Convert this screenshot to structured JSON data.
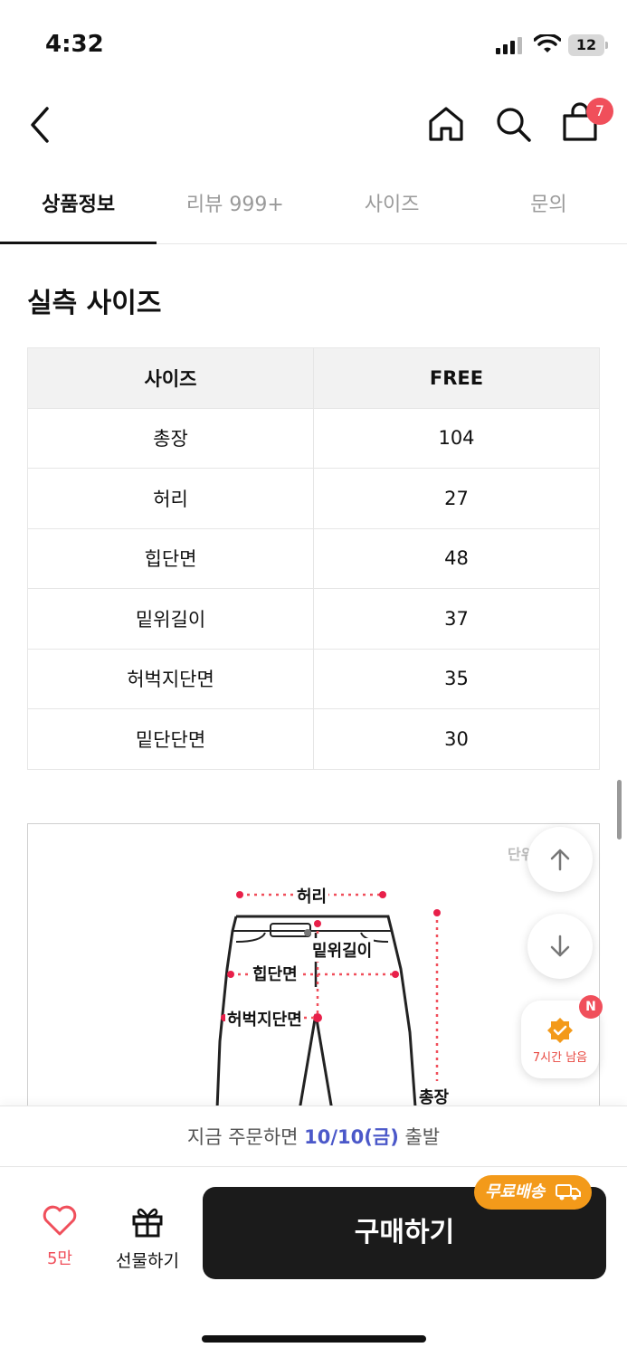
{
  "status_bar": {
    "time": "4:32",
    "battery": "12"
  },
  "header": {
    "cart_count": "7"
  },
  "tabs": [
    {
      "label": "상품정보",
      "active": true
    },
    {
      "label": "리뷰 999+",
      "active": false
    },
    {
      "label": "사이즈",
      "active": false
    },
    {
      "label": "문의",
      "active": false
    }
  ],
  "section_title": "실측 사이즈",
  "size_table": {
    "headers": [
      "사이즈",
      "FREE"
    ],
    "rows": [
      [
        "총장",
        "104"
      ],
      [
        "허리",
        "27"
      ],
      [
        "힙단면",
        "48"
      ],
      [
        "밑위길이",
        "37"
      ],
      [
        "허벅지단면",
        "35"
      ],
      [
        "밑단단면",
        "30"
      ]
    ]
  },
  "diagram": {
    "unit_label": "단위",
    "labels": {
      "waist": "허리",
      "rise": "밑위길이",
      "hip": "힙단면",
      "thigh": "허벅지단면",
      "length": "총장"
    }
  },
  "promo": {
    "text": "7시간 남음",
    "badge": "N"
  },
  "notice": {
    "prefix": "지금 주문하면 ",
    "date": "10/10(금)",
    "suffix": " 출발"
  },
  "bottom_bar": {
    "like_count": "5만",
    "gift_label": "선물하기",
    "buy_label": "구매하기",
    "free_shipping_label": "무료배송"
  },
  "colors": {
    "accent": "#f04f5b",
    "date_blue": "#4b58c9",
    "shipping_orange": "#f39a1a",
    "buy_bg": "#1b1b1b"
  }
}
